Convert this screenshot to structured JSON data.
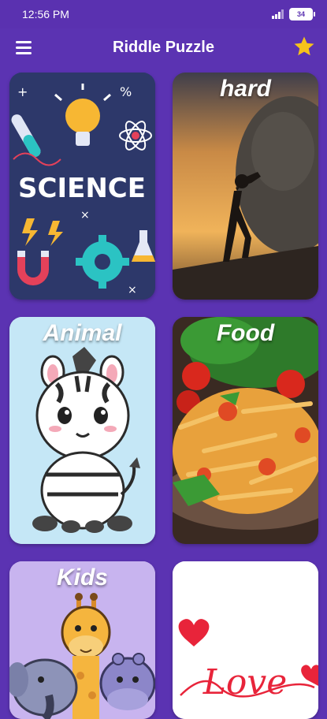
{
  "status_bar": {
    "time": "12:56 PM",
    "battery": "34"
  },
  "app_bar": {
    "title": "Riddle Puzzle",
    "menu_icon": "hamburger-menu-icon",
    "favorite_icon": "star-icon"
  },
  "colors": {
    "background": "#5b33b2",
    "star": "#f6c21b"
  },
  "categories": [
    {
      "title": ""
    },
    {
      "title": "hard"
    },
    {
      "title": "Animal"
    },
    {
      "title": "Food"
    },
    {
      "title": "Kids"
    },
    {
      "title": ""
    }
  ],
  "science_card": {
    "text": "SCIENCE"
  },
  "love_card": {
    "text": "Love"
  }
}
